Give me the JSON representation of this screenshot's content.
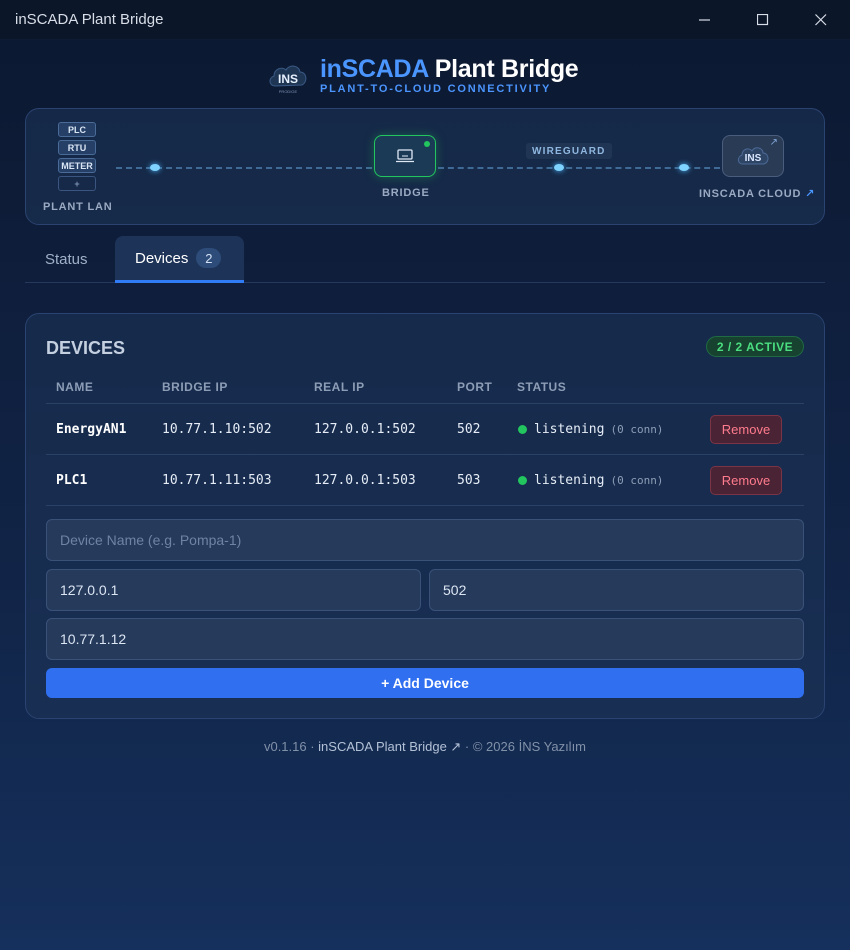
{
  "window": {
    "title": "inSCADA Plant Bridge",
    "controls": [
      "minimize-icon",
      "maximize-icon",
      "close-icon"
    ]
  },
  "header": {
    "logo_text": "INS",
    "logo_sub": "PRODIGE",
    "title_accent": "inSCADA",
    "title_rest": "Plant Bridge",
    "subtitle": "PLANT-TO-CLOUD CONNECTIVITY"
  },
  "topology": {
    "plant_chips": [
      "PLC",
      "RTU",
      "METER",
      "+"
    ],
    "plant_label": "PLANT LAN",
    "bridge_label": "BRIDGE",
    "tunnel_label": "WIREGUARD",
    "cloud_label": "INSCADA CLOUD",
    "cloud_arrow": "↗",
    "cloud_logo_text": "INS",
    "colors": {
      "online": "#22c55e",
      "link": "#7fd3ff"
    }
  },
  "tabs": [
    {
      "label": "Status"
    },
    {
      "label": "Devices",
      "count": "2",
      "active": true
    }
  ],
  "devices_panel": {
    "title": "DEVICES",
    "active_badge": "2 / 2 ACTIVE",
    "columns": [
      "NAME",
      "BRIDGE IP",
      "REAL IP",
      "PORT",
      "STATUS"
    ],
    "rows": [
      {
        "name": "EnergyAN1",
        "bridge_ip": "10.77.1.10:502",
        "real_ip": "127.0.0.1:502",
        "port": "502",
        "status": "listening",
        "conn": "(0 conn)",
        "action": "Remove"
      },
      {
        "name": "PLC1",
        "bridge_ip": "10.77.1.11:503",
        "real_ip": "127.0.0.1:503",
        "port": "503",
        "status": "listening",
        "conn": "(0 conn)",
        "action": "Remove"
      }
    ],
    "form": {
      "name_placeholder": "Device Name (e.g. Pompa-1)",
      "name_value": "",
      "real_ip_value": "127.0.0.1",
      "port_value": "502",
      "bridge_ip_value": "10.77.1.12",
      "add_label": "+ Add Device"
    }
  },
  "footer": {
    "version": "v0.1.16 · ",
    "link": "inSCADA Plant Bridge ↗",
    "copyright": " · © 2026 İNS Yazılım"
  }
}
